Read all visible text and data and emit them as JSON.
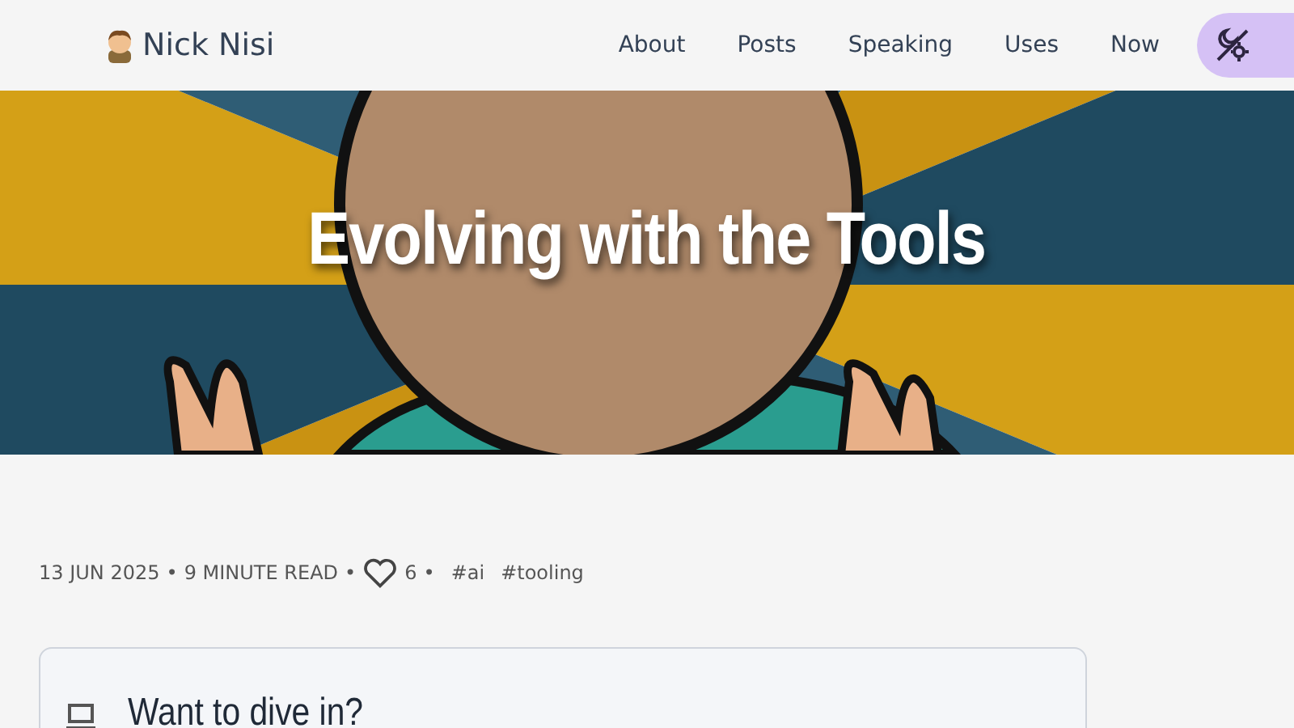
{
  "header": {
    "site_name": "Nick Nisi",
    "nav": [
      {
        "label": "About"
      },
      {
        "label": "Posts"
      },
      {
        "label": "Speaking"
      },
      {
        "label": "Uses"
      },
      {
        "label": "Now"
      }
    ]
  },
  "hero": {
    "kind": "picture",
    "title": "Evolving with the Tools"
  },
  "meta": {
    "date": "13 JUN 2025",
    "separators": [
      "•",
      "•",
      "•"
    ],
    "read_time": "9 MINUTE READ",
    "likes": "6",
    "tags": [
      "#ai",
      "#tooling"
    ]
  },
  "card": {
    "heading": "Want to dive in?"
  }
}
